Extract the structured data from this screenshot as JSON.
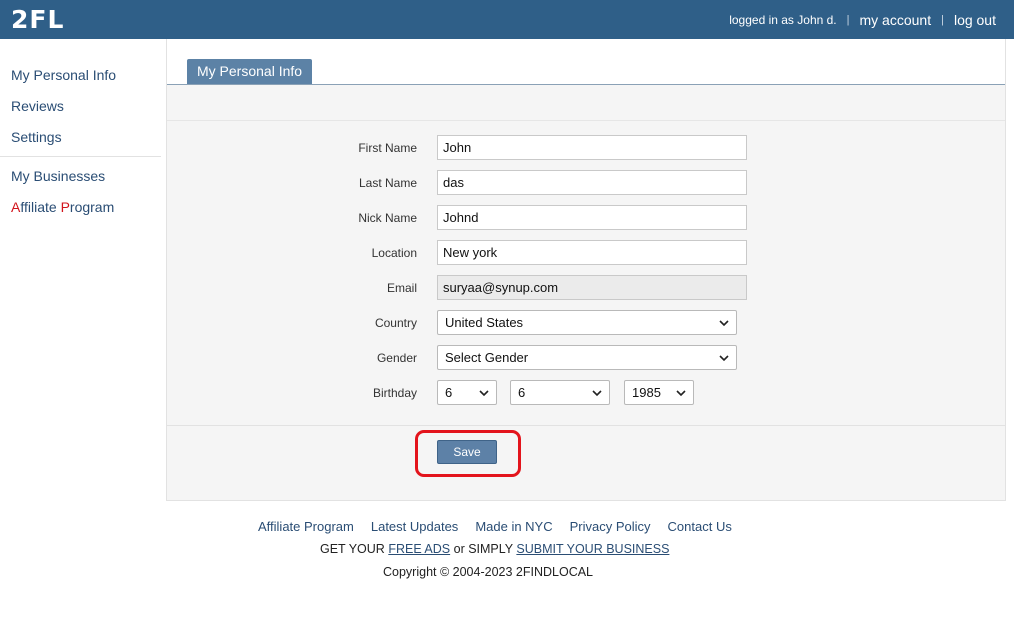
{
  "header": {
    "logo": "2FL",
    "logged_in": "logged in as John d.",
    "my_account": "my account",
    "log_out": "log out",
    "separator": "|"
  },
  "sidebar": {
    "items": [
      {
        "label": "My Personal Info"
      },
      {
        "label": "Reviews"
      },
      {
        "label": "Settings"
      },
      {
        "label": "My Businesses"
      }
    ],
    "affiliate": {
      "a": "A",
      "ffiliate": "ffiliate ",
      "p": "P",
      "rogram": "rogram"
    }
  },
  "tab": {
    "label": "My Personal Info"
  },
  "form": {
    "first_name": {
      "label": "First Name",
      "value": "John"
    },
    "last_name": {
      "label": "Last Name",
      "value": "das"
    },
    "nick_name": {
      "label": "Nick Name",
      "value": "Johnd"
    },
    "location": {
      "label": "Location",
      "value": "New york"
    },
    "email": {
      "label": "Email",
      "value": "suryaa@synup.com"
    },
    "country": {
      "label": "Country",
      "value": "United States"
    },
    "gender": {
      "label": "Gender",
      "value": "Select Gender"
    },
    "birthday": {
      "label": "Birthday",
      "month": "6",
      "day": "6",
      "year": "1985"
    },
    "save": "Save"
  },
  "footer": {
    "links": [
      "Affiliate Program",
      "Latest Updates",
      "Made in NYC",
      "Privacy Policy",
      "Contact Us"
    ],
    "get_your": "GET YOUR ",
    "free_ads": "FREE ADS",
    "or_simply": " or SIMPLY ",
    "submit": "SUBMIT YOUR BUSINESS",
    "copyright": "Copyright © 2004-2023 2FINDLOCAL"
  },
  "colors": {
    "header_bg": "#2f5f88",
    "tab_bg": "#5c82a6",
    "link": "#2a4d74",
    "highlight": "#e3141c"
  }
}
